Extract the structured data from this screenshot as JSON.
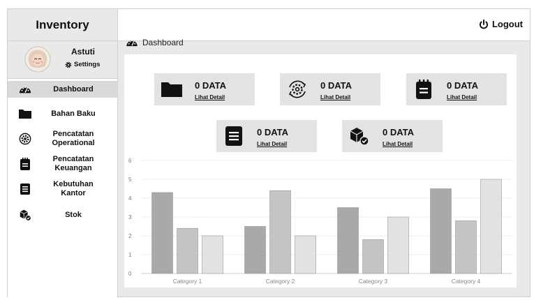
{
  "sidebar": {
    "brand": "Inventory",
    "profile": {
      "name": "Astuti",
      "settings_label": "Settings"
    },
    "items": [
      {
        "label": "Dashboard",
        "icon": "tachometer-icon",
        "active": true
      },
      {
        "label": "Bahan Baku",
        "icon": "folder-icon"
      },
      {
        "label": "Pencatatan Operational",
        "icon": "gear-sync-icon"
      },
      {
        "label": "Pencatatan Keuangan",
        "icon": "notepad-icon"
      },
      {
        "label": "Kebutuhan Kantor",
        "icon": "list-file-icon"
      },
      {
        "label": "Stok",
        "icon": "boxes-check-icon"
      }
    ]
  },
  "topbar": {
    "logout_label": "Logout"
  },
  "breadcrumb": {
    "label": "Dashboard"
  },
  "cards": [
    {
      "value": "0 DATA",
      "link": "Lihat Detail",
      "icon": "folder-icon"
    },
    {
      "value": "0 DATA",
      "link": "Lihat Detail",
      "icon": "gear-sync-icon"
    },
    {
      "value": "0 DATA",
      "link": "Lihat Detail",
      "icon": "notepad-icon"
    },
    {
      "value": "0 DATA",
      "link": "Lihat Detail",
      "icon": "list-file-icon"
    },
    {
      "value": "0 DATA",
      "link": "Lihat Detail",
      "icon": "boxes-check-icon"
    }
  ],
  "chart_data": {
    "type": "bar",
    "categories": [
      "Category 1",
      "Category 2",
      "Category 3",
      "Category 4"
    ],
    "series": [
      {
        "values": [
          4.3,
          2.5,
          3.5,
          4.5
        ],
        "color": "#a9a9a9"
      },
      {
        "values": [
          2.4,
          4.4,
          1.8,
          2.8
        ],
        "color": "#c4c4c4"
      },
      {
        "values": [
          2,
          2,
          3,
          5
        ],
        "color": "#e2e2e2"
      }
    ],
    "ylim": [
      0,
      6
    ],
    "yticks": [
      "0",
      "1",
      "2",
      "3",
      "4",
      "5",
      "6"
    ],
    "grid": true
  }
}
